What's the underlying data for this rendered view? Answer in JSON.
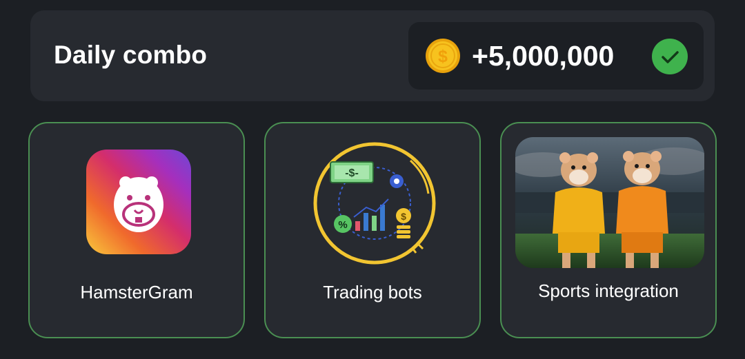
{
  "header": {
    "title": "Daily combo",
    "reward": "+5,000,000",
    "coin_icon": "gold-dollar-coin-icon",
    "status_icon": "green-check-icon"
  },
  "cards": [
    {
      "label": "HamsterGram",
      "image": "hamstergram-app-icon"
    },
    {
      "label": "Trading bots",
      "image": "trading-bots-illustration"
    },
    {
      "label": "Sports integration",
      "image": "hamsters-in-football-jerseys-photo"
    }
  ],
  "colors": {
    "background": "#1c1f24",
    "panel": "#272a30",
    "card_border": "#4a8f52",
    "check_green": "#3fb24d",
    "coin_gold": "#f5b91a"
  }
}
